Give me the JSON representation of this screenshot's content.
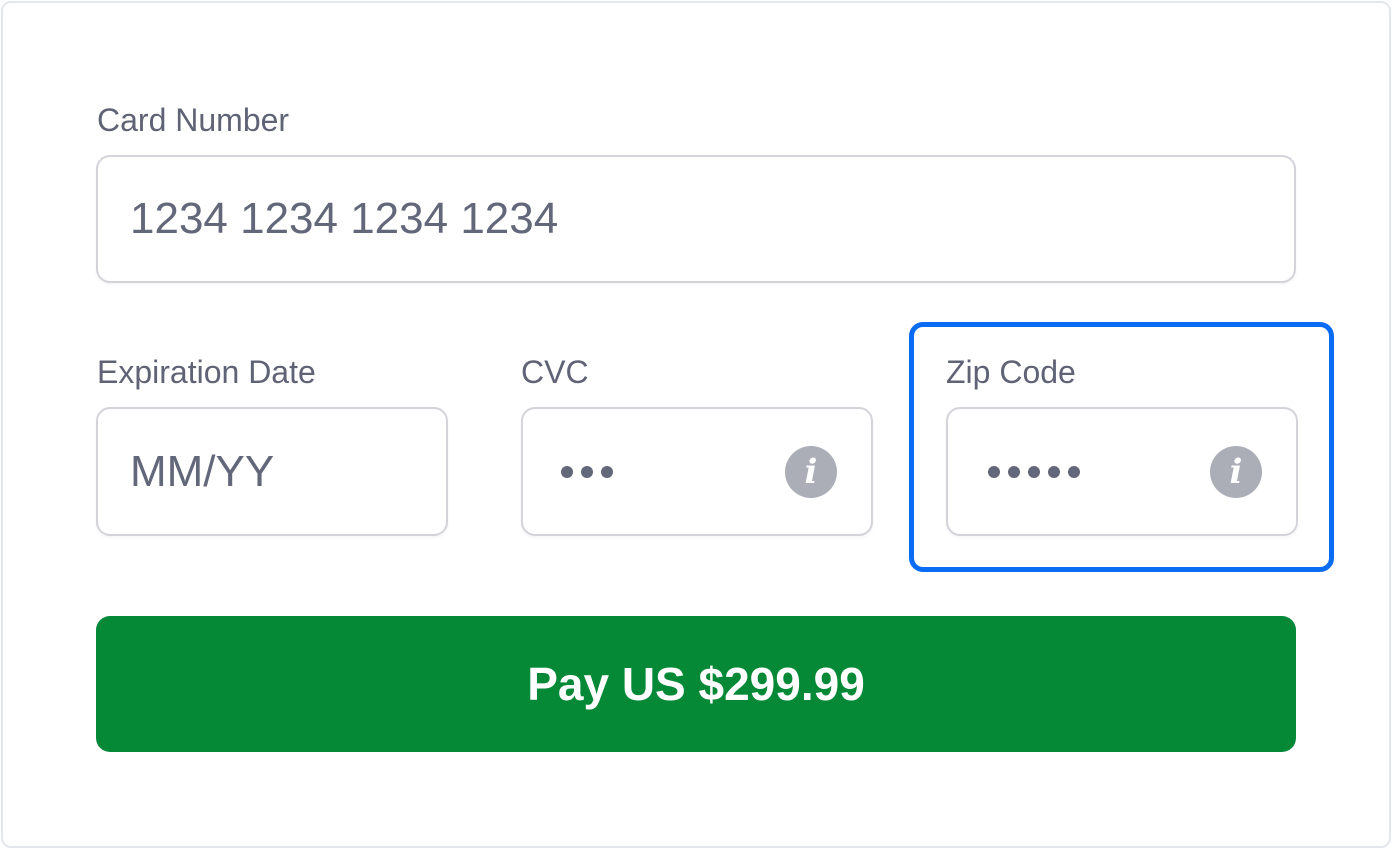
{
  "card_number": {
    "label": "Card Number",
    "placeholder": "1234 1234 1234 1234",
    "value": ""
  },
  "expiration": {
    "label": "Expiration Date",
    "placeholder": "MM/YY",
    "value": ""
  },
  "cvc": {
    "label": "CVC",
    "masked_length": 3,
    "info_icon": "info-icon"
  },
  "zip": {
    "label": "Zip Code",
    "masked_length": 5,
    "info_icon": "info-icon",
    "focused": true
  },
  "pay_button": {
    "label": "Pay US $299.99"
  },
  "colors": {
    "accent_focus": "#0a6cf5",
    "pay_button_bg": "#058937",
    "label_text": "#5f6375",
    "input_border": "#d3d4d9",
    "info_icon_bg": "#abaeb7"
  }
}
